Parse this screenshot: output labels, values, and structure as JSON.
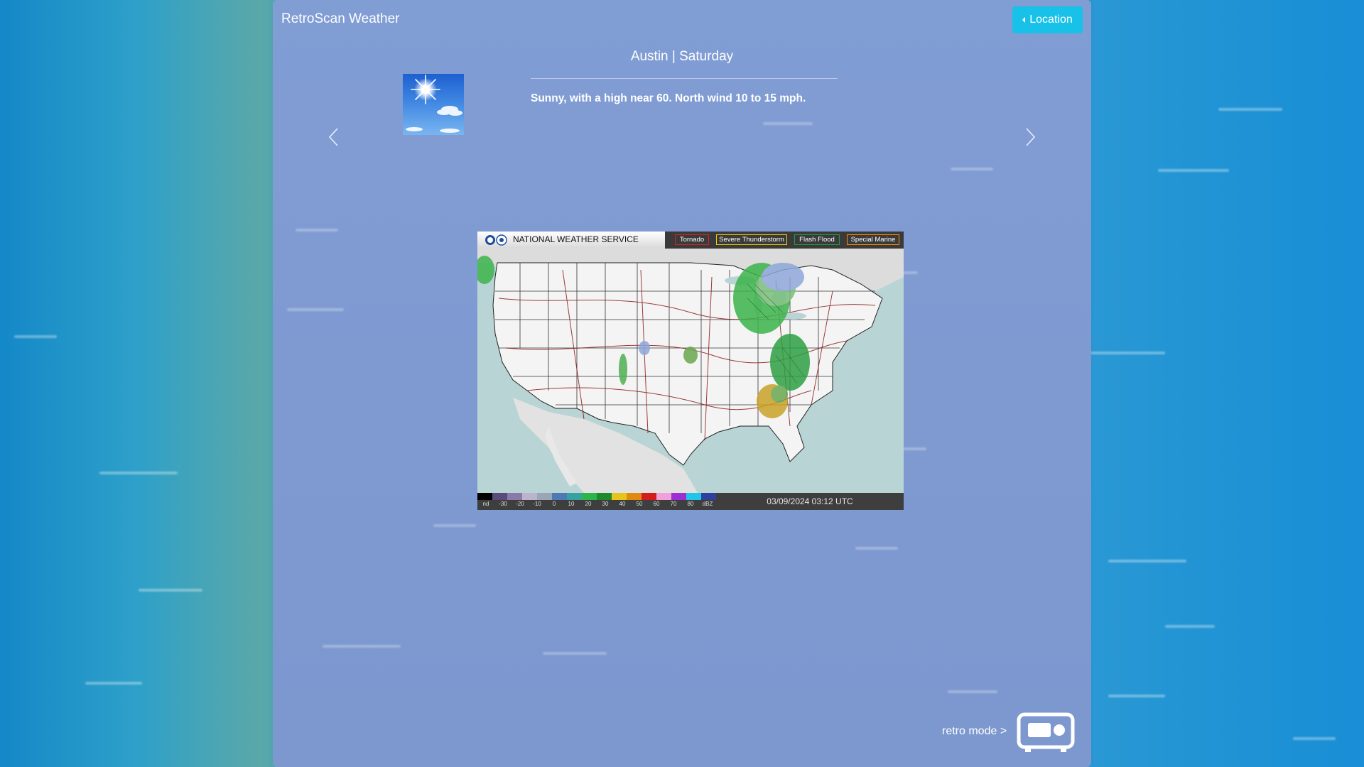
{
  "app": {
    "title": "RetroScan Weather",
    "location_button": "Location"
  },
  "forecast": {
    "heading": "Austin | Saturday",
    "text": "Sunny, with a high near 60. North wind 10 to 15 mph.",
    "icon": "sunny-icon"
  },
  "navigation": {
    "prev_icon": "chevron-left-icon",
    "next_icon": "chevron-right-icon"
  },
  "radar": {
    "agency": "NATIONAL WEATHER SERVICE",
    "alerts": [
      "Tornado",
      "Severe Thunderstorm",
      "Flash Flood",
      "Special Marine"
    ],
    "scale_labels": [
      "nd",
      "-30",
      "-20",
      "-10",
      "0",
      "10",
      "20",
      "30",
      "40",
      "50",
      "60",
      "70",
      "80",
      "dBZ"
    ],
    "timestamp": "03/09/2024 03:12 UTC"
  },
  "footer": {
    "retro_mode_label": "retro mode >",
    "retro_icon": "radio-icon"
  },
  "colors": {
    "panel": "#7e9bd2",
    "accent": "#17c1e8",
    "background": "#2e9ad4"
  }
}
